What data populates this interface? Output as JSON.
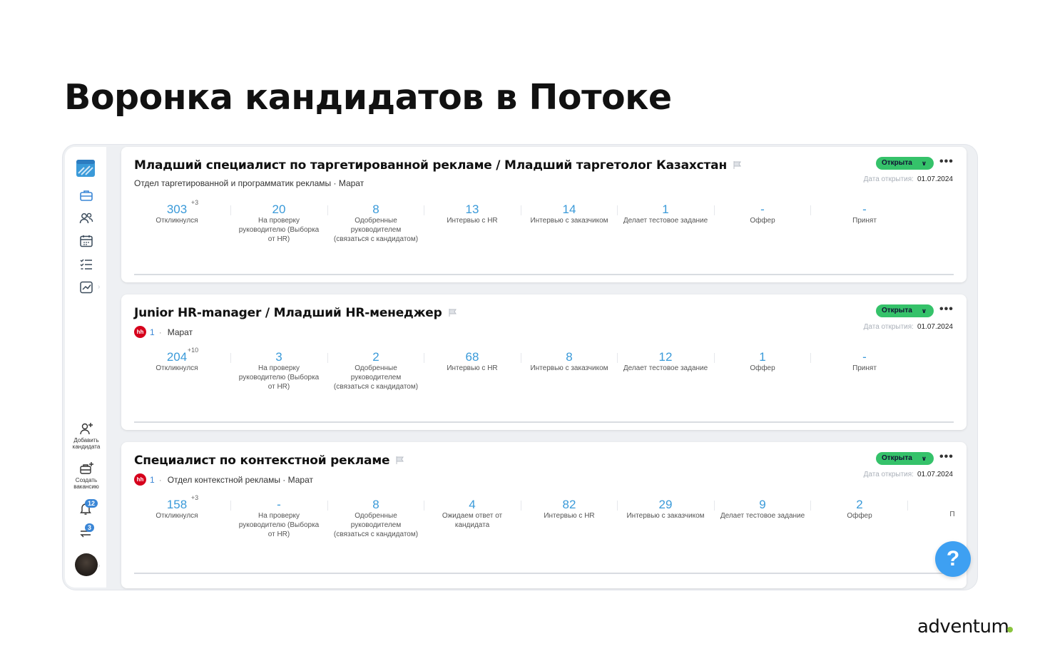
{
  "slide": {
    "title": "Воронка кандидатов в Потоке"
  },
  "brand": {
    "name": "adventum",
    "dot_color": "#8bc53f"
  },
  "colors": {
    "accent": "#3a86d6",
    "status_open": "#35c26a",
    "number_blue": "#3a9ad9",
    "hh_red": "#d6001c"
  },
  "sidebar": {
    "icons": [
      "logo-icon",
      "briefcase-icon",
      "users-icon",
      "calendar-icon",
      "checklist-icon",
      "chart-icon"
    ],
    "add_candidate_label": "Добавить кандидата",
    "create_vacancy_label": "Создать вакансию",
    "notifications_count": "12",
    "transfers_count": "3"
  },
  "vacancies": [
    {
      "title": "Младший специалист по таргетированной рекламе / Младший таргетолог Казахстан",
      "subtitle": "Отдел таргетированной и программатик рекламы · Марат",
      "status": "Открыта",
      "date_label": "Дата открытия:",
      "date": "01.07.2024",
      "stages": [
        {
          "value": "303",
          "extra": "+3",
          "label": "Откликнулся"
        },
        {
          "value": "20",
          "label": "На проверку руководителю (Выборка от HR)"
        },
        {
          "value": "8",
          "label": "Одобренные руководителем (связаться с кандидатом)"
        },
        {
          "value": "13",
          "label": "Интервью с HR"
        },
        {
          "value": "14",
          "label": "Интервью с заказчиком"
        },
        {
          "value": "1",
          "label": "Делает тестовое задание"
        },
        {
          "value": "-",
          "label": "Оффер"
        },
        {
          "value": "-",
          "label": "Принят"
        }
      ]
    },
    {
      "title": "Junior HR-manager / Младший HR-менеджер",
      "hh_badge": "hh",
      "hh_count": "1",
      "subtitle": "Марат",
      "status": "Открыта",
      "date_label": "Дата открытия:",
      "date": "01.07.2024",
      "stages": [
        {
          "value": "204",
          "extra": "+10",
          "label": "Откликнулся"
        },
        {
          "value": "3",
          "label": "На проверку руководителю (Выборка от HR)"
        },
        {
          "value": "2",
          "label": "Одобренные руководителем (связаться с кандидатом)"
        },
        {
          "value": "68",
          "label": "Интервью с HR"
        },
        {
          "value": "8",
          "label": "Интервью с заказчиком"
        },
        {
          "value": "12",
          "label": "Делает тестовое задание"
        },
        {
          "value": "1",
          "label": "Оффер"
        },
        {
          "value": "-",
          "label": "Принят"
        }
      ]
    },
    {
      "title": "Специалист по контекстной рекламе",
      "hh_badge": "hh",
      "hh_count": "1",
      "subtitle": "Отдел контекстной рекламы · Марат",
      "status": "Открыта",
      "date_label": "Дата открытия:",
      "date": "01.07.2024",
      "stages": [
        {
          "value": "158",
          "extra": "+3",
          "label": "Откликнулся"
        },
        {
          "value": "-",
          "label": "На проверку руководителю (Выборка от HR)"
        },
        {
          "value": "8",
          "label": "Одобренные руководителем (связаться с кандидатом)"
        },
        {
          "value": "4",
          "label": "Ожидаем ответ от кандидата"
        },
        {
          "value": "82",
          "label": "Интервью с HR"
        },
        {
          "value": "29",
          "label": "Интервью с заказчиком"
        },
        {
          "value": "9",
          "label": "Делает тестовое задание"
        },
        {
          "value": "2",
          "label": "Оффер"
        },
        {
          "value": "",
          "label": "П"
        }
      ]
    }
  ],
  "help_button": {
    "label": "?"
  }
}
